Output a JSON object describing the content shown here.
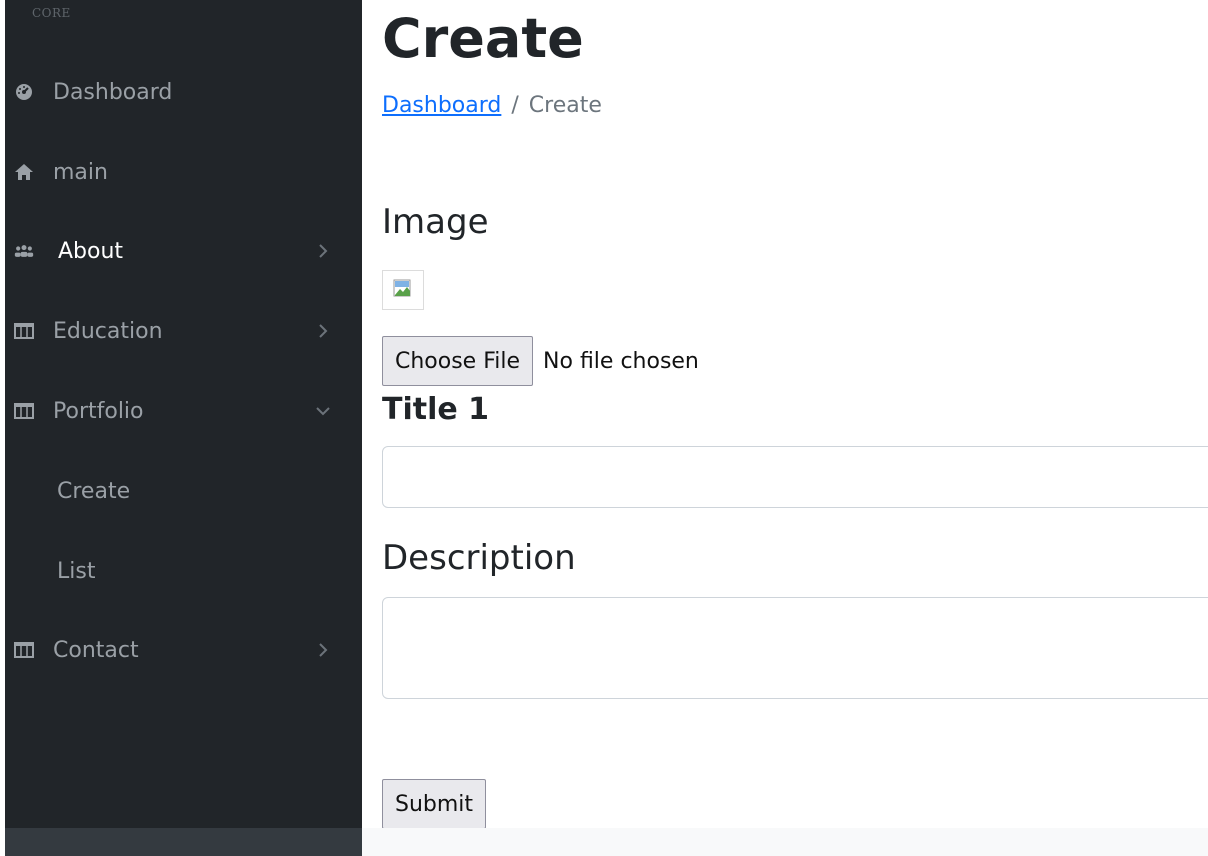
{
  "sidebar": {
    "heading": "CORE",
    "items": [
      {
        "label": "Dashboard",
        "icon": "tachometer-icon"
      },
      {
        "label": "main",
        "icon": "home-icon"
      },
      {
        "label": "About",
        "icon": "users-icon",
        "active": true,
        "chevron": "right"
      },
      {
        "label": "Education",
        "icon": "columns-icon",
        "chevron": "right"
      },
      {
        "label": "Portfolio",
        "icon": "columns-icon",
        "chevron": "down",
        "children": [
          {
            "label": "Create"
          },
          {
            "label": "List"
          }
        ]
      },
      {
        "label": "Contact",
        "icon": "columns-icon",
        "chevron": "right"
      }
    ]
  },
  "main": {
    "title": "Create",
    "breadcrumb": {
      "link": "Dashboard",
      "separator": "/",
      "current": "Create"
    },
    "image_label": "Image",
    "file_button": "Choose File",
    "file_status": "No file chosen",
    "title_label": "Title 1",
    "title_value": "",
    "description_label": "Description",
    "description_value": "",
    "submit_label": "Submit"
  },
  "colors": {
    "sidebar_bg": "#212529",
    "sidebar_text": "#9aa0a6",
    "active_text": "#ffffff",
    "link": "#0d6efd"
  }
}
